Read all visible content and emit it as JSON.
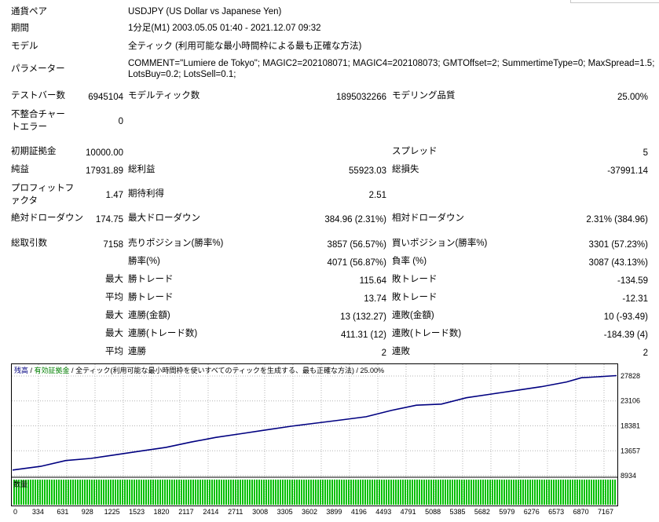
{
  "report": {
    "symbol_label": "通貨ペア",
    "symbol_value": "USDJPY (US Dollar vs Japanese Yen)",
    "period_label": "期間",
    "period_value": "1分足(M1) 2003.05.05 01:40 - 2021.12.07 09:32",
    "model_label": "モデル",
    "model_value": "全ティック (利用可能な最小時間枠による最も正確な方法)",
    "params_label": "パラメーター",
    "params_line1": "COMMENT=\"Lumiere de Tokyo\"; MAGIC2=202108071; MAGIC4=202108073; GMTOffset=2; SummertimeType=0; MaxSpread=1.5;",
    "params_line2": "LotsBuy=0.2; LotsSell=0.1;"
  },
  "stats": {
    "bars_label": "テストバー数",
    "bars_value": "6945104",
    "ticks_label": "モデルティック数",
    "ticks_value": "1895032266",
    "quality_label": "モデリング品質",
    "quality_value": "25.00%",
    "mismatch_label": "不整合チャートエラー",
    "mismatch_value": "0",
    "deposit_label": "初期証拠金",
    "deposit_value": "10000.00",
    "spread_label": "スプレッド",
    "spread_value": "5",
    "net_label": "純益",
    "net_value": "17931.89",
    "gross_profit_label": "総利益",
    "gross_profit_value": "55923.03",
    "gross_loss_label": "総損失",
    "gross_loss_value": "-37991.14",
    "pf_label": "プロフィットファクタ",
    "pf_value": "1.47",
    "expected_label": "期待利得",
    "expected_value": "2.51",
    "abs_dd_label": "絶対ドローダウン",
    "abs_dd_value": "174.75",
    "max_dd_label": "最大ドローダウン",
    "max_dd_value": "384.96 (2.31%)",
    "rel_dd_label": "相対ドローダウン",
    "rel_dd_value": "2.31% (384.96)",
    "trades_label": "総取引数",
    "trades_value": "7158",
    "short_label": "売りポジション(勝率%)",
    "short_value": "3857 (56.57%)",
    "long_label": "買いポジション(勝率%)",
    "long_value": "3301 (57.23%)",
    "winrate_label": "勝率(%)",
    "winrate_value": "4071 (56.87%)",
    "lossrate_label": "負率 (%)",
    "lossrate_value": "3087 (43.13%)",
    "max_label": "最大",
    "avg_label": "平均",
    "win_trade_label": "勝トレード",
    "max_win_value": "115.64",
    "loss_trade_label": "敗トレード",
    "max_loss_value": "-134.59",
    "avg_win_value": "13.74",
    "avg_loss_value": "-12.31",
    "cons_win_amt_label": "連勝(金額)",
    "cons_win_amt_value": "13 (132.27)",
    "cons_loss_amt_label": "連敗(金額)",
    "cons_loss_amt_value": "10 (-93.49)",
    "cons_win_cnt_label": "連勝(トレード数)",
    "cons_win_cnt_value": "411.31 (12)",
    "cons_loss_cnt_label": "連敗(トレード数)",
    "cons_loss_cnt_value": "-184.39 (4)",
    "avg_cons_win_label": "連勝",
    "avg_cons_win_value": "2",
    "avg_cons_loss_label": "連敗",
    "avg_cons_loss_value": "2"
  },
  "graph_header": {
    "balance": "残高",
    "sep1": " / ",
    "margin": "有効証拠金",
    "sep2": " / ",
    "model": "全ティック(利用可能な最小時間枠を使いすべてのティックを生成する、最も正確な方法)",
    "sep3": " / ",
    "quality": "25.00%"
  },
  "lots_label": "数量",
  "colors": {
    "balance": "#000080",
    "margin": "#008000",
    "volume": "#00c000",
    "grid": "#b4b4b4"
  },
  "chart_data": {
    "type": "line",
    "title": "",
    "xlabel": "",
    "ylabel": "",
    "x_ticks": [
      "0",
      "334",
      "631",
      "928",
      "1225",
      "1523",
      "1820",
      "2117",
      "2414",
      "2711",
      "3008",
      "3305",
      "3602",
      "3899",
      "4196",
      "4493",
      "4791",
      "5088",
      "5385",
      "5682",
      "5979",
      "6276",
      "6573",
      "6870",
      "7167"
    ],
    "y_ticks": [
      "27828",
      "23106",
      "18381",
      "13657",
      "8934"
    ],
    "ylim": [
      8934,
      27828
    ],
    "xlim": [
      0,
      7167
    ],
    "series": [
      {
        "name": "残高",
        "x": [
          0,
          334,
          631,
          928,
          1225,
          1523,
          1820,
          2117,
          2414,
          2711,
          3008,
          3305,
          3602,
          3899,
          4196,
          4493,
          4791,
          5088,
          5385,
          5682,
          5979,
          6276,
          6573,
          6750,
          6870,
          7167
        ],
        "y": [
          10000,
          10700,
          11800,
          12200,
          12900,
          13600,
          14300,
          15300,
          16200,
          16900,
          17600,
          18300,
          18900,
          19500,
          20100,
          21300,
          22300,
          22500,
          23700,
          24400,
          25100,
          25800,
          26700,
          27500,
          27600,
          27900
        ]
      }
    ]
  }
}
